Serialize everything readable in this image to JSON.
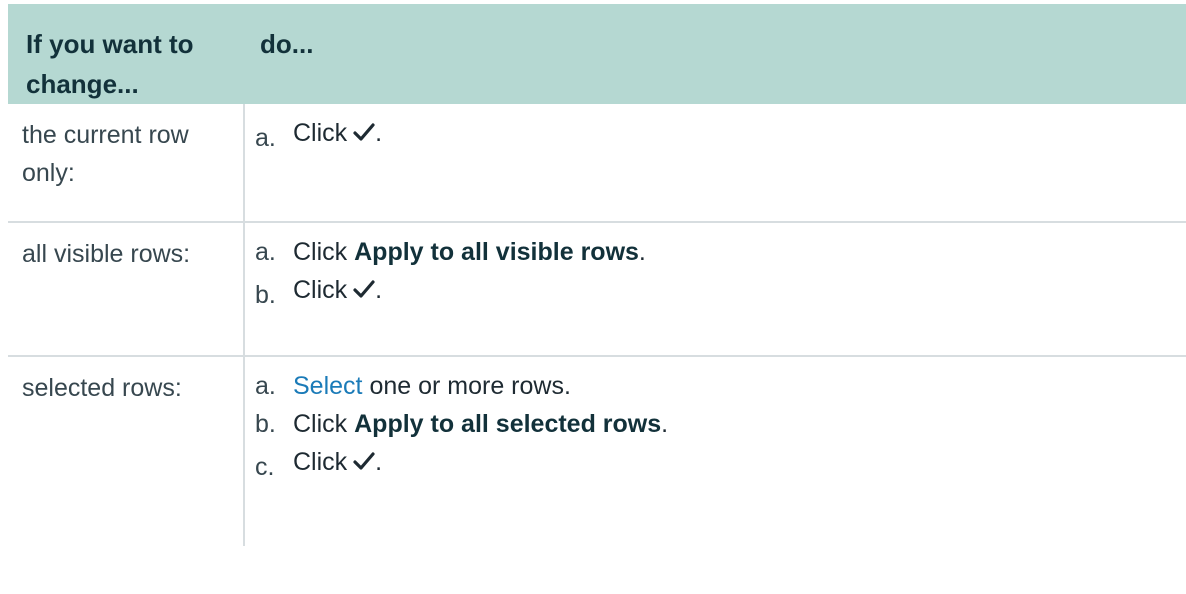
{
  "table": {
    "header": {
      "col1": "If you want to change...",
      "col2": "do..."
    },
    "rows": [
      {
        "condition": "the current row only:",
        "steps": [
          {
            "marker": "a.",
            "prefix": "Click",
            "suffix": ".",
            "icon": "checkmark-icon"
          }
        ]
      },
      {
        "condition": "all visible rows:",
        "steps": [
          {
            "marker": "a.",
            "prefix": "Click",
            "bold": "Apply to all visible rows",
            "suffix": "."
          },
          {
            "marker": "b.",
            "prefix": "Click",
            "suffix": ".",
            "icon": "checkmark-icon"
          }
        ]
      },
      {
        "condition": "selected rows:",
        "steps": [
          {
            "marker": "a.",
            "link": "Select",
            "rest": "one or more rows."
          },
          {
            "marker": "b.",
            "prefix": "Click",
            "bold": "Apply to all selected rows",
            "suffix": "."
          },
          {
            "marker": "c.",
            "prefix": "Click",
            "suffix": ".",
            "icon": "checkmark-icon"
          }
        ]
      }
    ]
  },
  "colors": {
    "header_bg": "#b5d8d2",
    "header_text": "#12313a",
    "link": "#1b7bb8",
    "border": "#d7dde0"
  }
}
